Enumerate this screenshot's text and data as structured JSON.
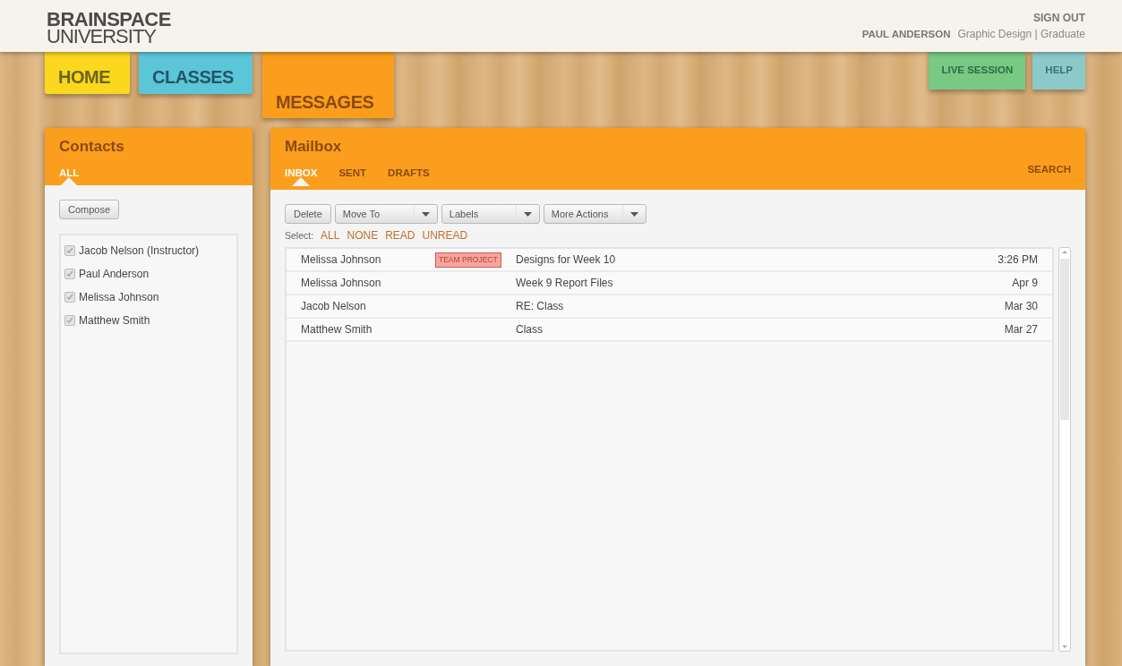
{
  "brand": {
    "line_1": "BRAINSPACE",
    "line_2": "UNIVERSITY"
  },
  "user": {
    "sign_out": "SIGN OUT",
    "name": "PAUL ANDERSON",
    "program": "Graphic Design | Graduate"
  },
  "main_nav": [
    {
      "label": "HOME",
      "color": "#fbd81d",
      "selected": false
    },
    {
      "label": "CLASSES",
      "color": "#5ac6d8",
      "selected": false
    },
    {
      "label": "MESSAGES",
      "color": "#fb9e1e",
      "selected": true
    }
  ],
  "side_nav": [
    {
      "label": "LIVE SESSION",
      "color": "#78c983"
    },
    {
      "label": "HELP",
      "color": "#8ccaca"
    }
  ],
  "contacts": {
    "title": "Contacts",
    "tabs": [
      {
        "label": "ALL",
        "selected": true
      }
    ],
    "compose": "Compose",
    "list": [
      {
        "name": "Jacob Nelson (Instructor)",
        "checked": true
      },
      {
        "name": "Paul Anderson",
        "checked": true
      },
      {
        "name": "Melissa Johnson",
        "checked": true
      },
      {
        "name": "Matthew Smith",
        "checked": true
      }
    ]
  },
  "mailbox": {
    "title": "Mailbox",
    "tabs": [
      {
        "label": "INBOX",
        "selected": true
      },
      {
        "label": "SENT",
        "selected": false
      },
      {
        "label": "DRAFTS",
        "selected": false
      }
    ],
    "search": "SEARCH",
    "actions": [
      {
        "label": "Delete",
        "kind": "button"
      },
      {
        "label": "Move To",
        "kind": "dropdown"
      },
      {
        "label": "Labels",
        "kind": "dropdown"
      },
      {
        "label": "More Actions",
        "kind": "dropdown"
      }
    ],
    "select_label": "Select:",
    "select_links": [
      "ALL",
      "NONE",
      "READ",
      "UNREAD"
    ],
    "messages": [
      {
        "sender": "Melissa Johnson",
        "tag": "TEAM PROJECT",
        "subject": "Designs for Week 10",
        "time": "3:26 PM"
      },
      {
        "sender": "Melissa Johnson",
        "subject": "Week 9 Report Files",
        "time": "Apr 9"
      },
      {
        "sender": "Jacob Nelson",
        "subject": "RE: Class",
        "time": "Mar 30"
      },
      {
        "sender": "Matthew Smith",
        "subject": "Class",
        "time": "Mar 27"
      }
    ]
  }
}
